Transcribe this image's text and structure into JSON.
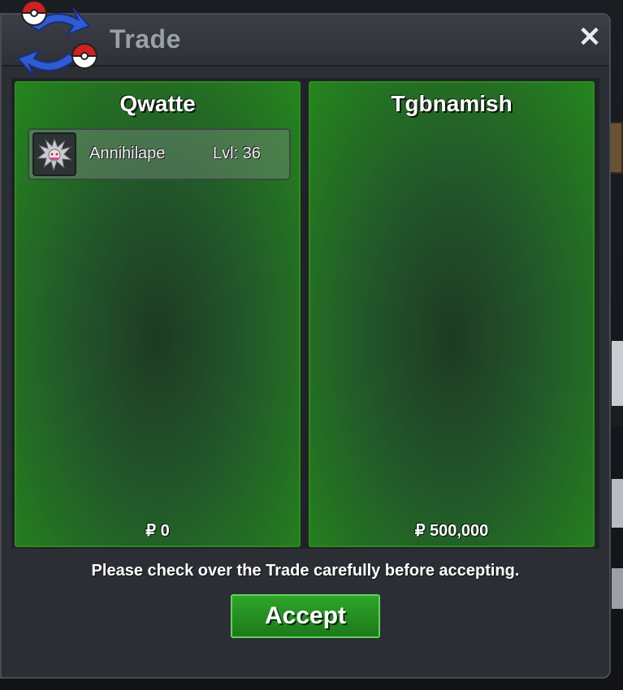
{
  "window": {
    "title": "Trade",
    "close_label": "✕"
  },
  "trade": {
    "left_player": {
      "name": "Qwatte",
      "items": [
        {
          "name": "Annihilape",
          "level": "Lvl: 36",
          "icon": "annihilape-sprite"
        }
      ],
      "money": "₽ 0"
    },
    "right_player": {
      "name": "Tgbnamish",
      "items": [],
      "money": "₽ 500,000"
    }
  },
  "footer": {
    "notice": "Please check over the Trade carefully before accepting.",
    "accept_label": "Accept"
  },
  "colors": {
    "panel_green": "#25851d",
    "accept_green": "#2ea52a",
    "window_bg": "#2b2e34"
  }
}
